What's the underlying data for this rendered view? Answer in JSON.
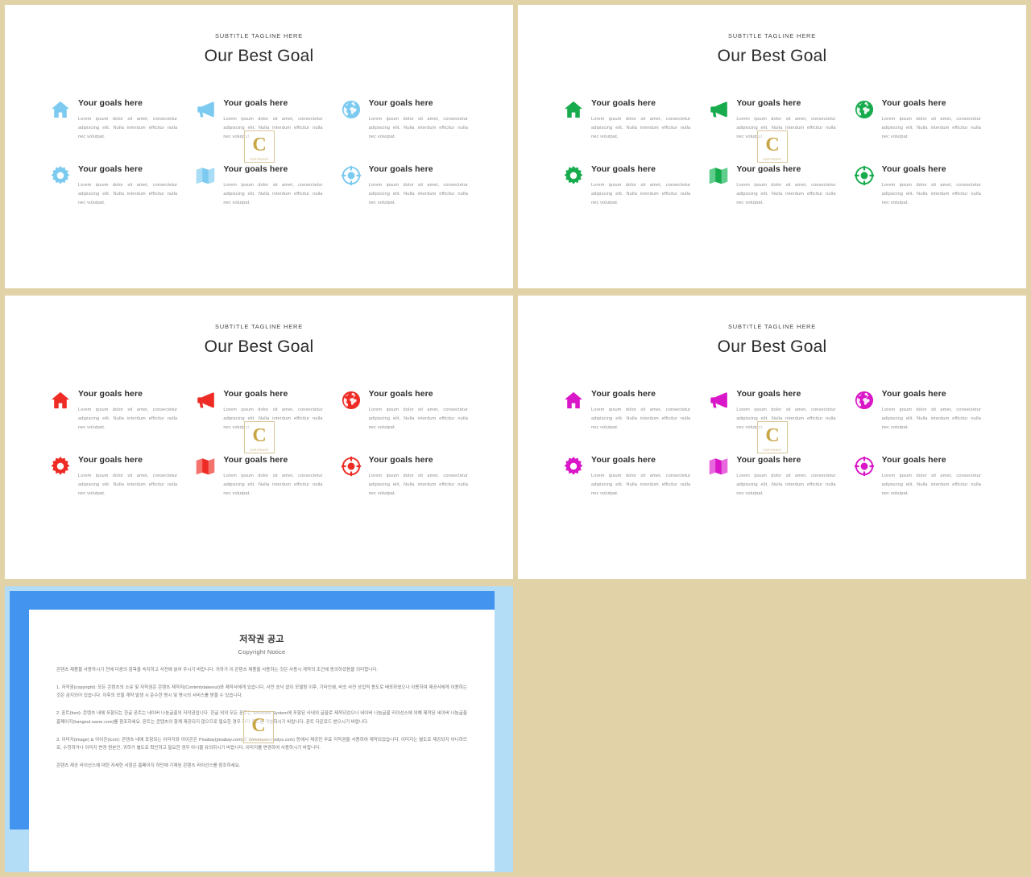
{
  "theme": {
    "page_background": "#e2d2a8",
    "slide_background": "#ffffff",
    "title_color": "#2b2b2b",
    "body_color": "#8d8d8d"
  },
  "slides": [
    {
      "id": "slide-blue",
      "accent": "#7ccaf0",
      "subtitle": "SUBTITLE TAGLINE HERE",
      "title": "Our Best Goal",
      "items": [
        {
          "icon": "home-icon",
          "title": "Your goals here",
          "desc": "Lorem ipsum dolor sit amet, consectetur adipiscing elit. Nulla interdum efficitur nulla nec volutpat."
        },
        {
          "icon": "megaphone-icon",
          "title": "Your goals here",
          "desc": "Lorem ipsum dolor sit amet, consectetur adipiscing elit. Nulla interdum efficitur nulla nec volutpat."
        },
        {
          "icon": "globe-icon",
          "title": "Your goals here",
          "desc": "Lorem ipsum dolor sit amet, consectetur adipiscing elit. Nulla interdum efficitur nulla nec volutpat."
        },
        {
          "icon": "gear-icon",
          "title": "Your goals here",
          "desc": "Lorem ipsum dolor sit amet, consectetur adipiscing elit. Nulla interdum efficitur nulla nec volutpat."
        },
        {
          "icon": "map-icon",
          "title": "Your goals here",
          "desc": "Lorem ipsum dolor sit amet, consectetur adipiscing elit. Nulla interdum efficitur nulla nec volutpat."
        },
        {
          "icon": "target-icon",
          "title": "Your goals here",
          "desc": "Lorem ipsum dolor sit amet, consectetur adipiscing elit. Nulla interdum efficitur nulla nec volutpat."
        }
      ]
    },
    {
      "id": "slide-green",
      "accent": "#17ab4d",
      "subtitle": "SUBTITLE TAGLINE HERE",
      "title": "Our Best Goal",
      "items": [
        {
          "icon": "home-icon",
          "title": "Your goals here",
          "desc": "Lorem ipsum dolor sit amet, consectetur adipiscing elit. Nulla interdum efficitur nulla nec volutpat."
        },
        {
          "icon": "megaphone-icon",
          "title": "Your goals here",
          "desc": "Lorem ipsum dolor sit amet, consectetur adipiscing elit. Nulla interdum efficitur nulla nec volutpat."
        },
        {
          "icon": "globe-icon",
          "title": "Your goals here",
          "desc": "Lorem ipsum dolor sit amet, consectetur adipiscing elit. Nulla interdum efficitur nulla nec volutpat."
        },
        {
          "icon": "gear-icon",
          "title": "Your goals here",
          "desc": "Lorem ipsum dolor sit amet, consectetur adipiscing elit. Nulla interdum efficitur nulla nec volutpat."
        },
        {
          "icon": "map-icon",
          "title": "Your goals here",
          "desc": "Lorem ipsum dolor sit amet, consectetur adipiscing elit. Nulla interdum efficitur nulla nec volutpat."
        },
        {
          "icon": "target-icon",
          "title": "Your goals here",
          "desc": "Lorem ipsum dolor sit amet, consectetur adipiscing elit. Nulla interdum efficitur nulla nec volutpat."
        }
      ]
    },
    {
      "id": "slide-red",
      "accent": "#ee2b24",
      "subtitle": "SUBTITLE TAGLINE HERE",
      "title": "Our Best Goal",
      "items": [
        {
          "icon": "home-icon",
          "title": "Your goals here",
          "desc": "Lorem ipsum dolor sit amet, consectetur adipiscing elit. Nulla interdum efficitur nulla nec volutpat."
        },
        {
          "icon": "megaphone-icon",
          "title": "Your goals here",
          "desc": "Lorem ipsum dolor sit amet, consectetur adipiscing elit. Nulla interdum efficitur nulla nec volutpat."
        },
        {
          "icon": "globe-icon",
          "title": "Your goals here",
          "desc": "Lorem ipsum dolor sit amet, consectetur adipiscing elit. Nulla interdum efficitur nulla nec volutpat."
        },
        {
          "icon": "gear-icon",
          "title": "Your goals here",
          "desc": "Lorem ipsum dolor sit amet, consectetur adipiscing elit. Nulla interdum efficitur nulla nec volutpat."
        },
        {
          "icon": "map-icon",
          "title": "Your goals here",
          "desc": "Lorem ipsum dolor sit amet, consectetur adipiscing elit. Nulla interdum efficitur nulla nec volutpat."
        },
        {
          "icon": "target-icon",
          "title": "Your goals here",
          "desc": "Lorem ipsum dolor sit amet, consectetur adipiscing elit. Nulla interdum efficitur nulla nec volutpat."
        }
      ]
    },
    {
      "id": "slide-magenta",
      "accent": "#d916c8",
      "subtitle": "SUBTITLE TAGLINE HERE",
      "title": "Our Best Goal",
      "items": [
        {
          "icon": "home-icon",
          "title": "Your goals here",
          "desc": "Lorem ipsum dolor sit amet, consectetur adipiscing elit. Nulla interdum efficitur nulla nec volutpat."
        },
        {
          "icon": "megaphone-icon",
          "title": "Your goals here",
          "desc": "Lorem ipsum dolor sit amet, consectetur adipiscing elit. Nulla interdum efficitur nulla nec volutpat."
        },
        {
          "icon": "globe-icon",
          "title": "Your goals here",
          "desc": "Lorem ipsum dolor sit amet, consectetur adipiscing elit. Nulla interdum efficitur nulla nec volutpat."
        },
        {
          "icon": "gear-icon",
          "title": "Your goals here",
          "desc": "Lorem ipsum dolor sit amet, consectetur adipiscing elit. Nulla interdum efficitur nulla nec volutpat."
        },
        {
          "icon": "map-icon",
          "title": "Your goals here",
          "desc": "Lorem ipsum dolor sit amet, consectetur adipiscing elit. Nulla interdum efficitur nulla nec volutpat."
        },
        {
          "icon": "target-icon",
          "title": "Your goals here",
          "desc": "Lorem ipsum dolor sit amet, consectetur adipiscing elit. Nulla interdum efficitur nulla nec volutpat."
        }
      ]
    }
  ],
  "watermark": {
    "mark": "C",
    "caption": "COPYRIGHT",
    "color": "#c8a645"
  },
  "copyright_slide": {
    "frame_outer_color": "#b3ddf7",
    "frame_inner_color": "#4294ef",
    "title": "저작권 공고",
    "subtitle": "Copyright Notice",
    "paragraphs": [
      "콘텐츠 제품을 사용하시기 전에 다음의 항목을 숙지하고 사전에 읽어 주시기 바랍니다. 귀하가 이 콘텐츠 제품을 사용하는 것은 사용시 계약의 조건에 동의하셨음을 의미합니다.",
      "1. 저작권(copyright): 모든 콘텐츠의 소유 및 저작권은 콘텐츠 제작자(Contentstakeout)와 제작사에게 있습니다. 사전 승낙 없이 모델링 이후, 기타인쇄, 비슷 사진 상업적 용도로 배포하였으나 이용하여 제공사에게 이용하는 것은 금지되어 있습니다. 이후의 모델 계약 발생 시 준수한 명시 및 명시의 서비스를 받을 수 있습니다.",
      "2. 폰트(font): 콘텐츠 내에 포함되는 한글 폰트는 네이버 나눔글꼴의 저작권입니다. 한글 외의 모든 폰트는 Windows System에 포함된 사내의 글꼴로 제작되었으나 네이버 나눔글꼴 라이선스에 의해 제작된 네이버 나눔글꼴 홈페이지(hangeul.naver.com)를 참조하세요. 폰트는 콘텐츠의 함께 제공되지 않으므로 필요한 경우 각각 폰트를 개별하시기 바랍니다. 폰트 다운로드 받으시기 바랍니다.",
      "3. 이미지(image) & 아이콘(icon): 콘텐츠 내에 포함되는 이미지와 아이콘은 Pixabay(pixabay.com)와 Webolys(webolys.com) 등에서 제공한 무료 저작권을 사용하여 제작되었습니다. 이미지는 별도로 제공되지 아니하므로, 수정하거나 이미지 변경 원본인, 귀하가 별도로 확인하고 필요한 경우 아니물 유의하시기 바랍니다. 이미지를 변경하여 사용하시기 바랍니다.",
      "콘텐츠 제공 라이선스에 대한 자세한 사항은 홈페이지 하단에 기재된 콘텐츠 라이선스를 참조하세요."
    ]
  }
}
